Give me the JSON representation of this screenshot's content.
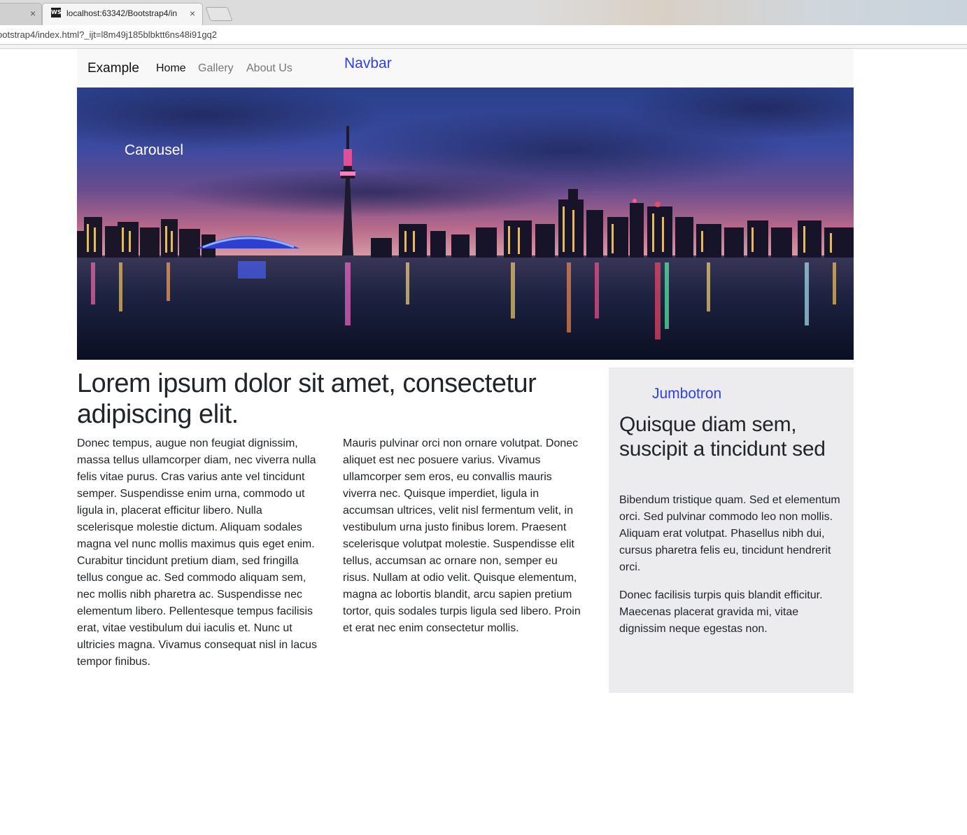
{
  "browser": {
    "inactive_tab_close": "×",
    "active_tab": {
      "favicon_text": "WS",
      "title": "localhost:63342/Bootstrap4/in",
      "close": "×"
    },
    "url": "ootstrap4/index.html?_ijt=l8m49j185blbktt6ns48i91gq2"
  },
  "navbar": {
    "brand": "Example",
    "links": [
      "Home",
      "Gallery",
      "About Us"
    ],
    "active_link": "Home",
    "annotation": "Navbar"
  },
  "carousel": {
    "annotation": "Carousel"
  },
  "main": {
    "heading": "Lorem ipsum dolor sit amet, consectetur adipiscing elit.",
    "column_left": "Donec tempus, augue non feugiat dignissim, massa tellus ullamcorper diam, nec viverra nulla felis vitae purus. Cras varius ante vel tincidunt semper. Suspendisse enim urna, commodo ut ligula in, placerat efficitur libero. Nulla scelerisque molestie dictum. Aliquam sodales magna vel nunc mollis maximus quis eget enim. Curabitur tincidunt pretium diam, sed fringilla tellus congue ac. Sed commodo aliquam sem, nec mollis nibh pharetra ac. Suspendisse nec elementum libero. Pellentesque tempus facilisis erat, vitae vestibulum dui iaculis et. Nunc ut ultricies magna. Vivamus consequat nisl in lacus tempor finibus.",
    "column_right": "Mauris pulvinar orci non ornare volutpat. Donec aliquet est nec posuere varius. Vivamus ullamcorper sem eros, eu convallis mauris viverra nec. Quisque imperdiet, ligula in accumsan ultrices, velit nisl fermentum velit, in vestibulum urna justo finibus lorem. Praesent scelerisque volutpat molestie. Suspendisse elit tellus, accumsan ac ornare non, semper eu risus. Nullam at odio velit. Quisque elementum, magna ac lobortis blandit, arcu sapien pretium tortor, quis sodales turpis ligula sed libero. Proin et erat nec enim consectetur mollis."
  },
  "jumbotron": {
    "annotation": "Jumbotron",
    "heading": "Quisque diam sem, suscipit a tincidunt sed",
    "paragraph_1": "Bibendum tristique quam. Sed et elementum orci. Sed pulvinar commodo leo non mollis. Aliquam erat volutpat. Phasellus nibh dui, cursus pharetra felis eu, tincidunt hendrerit orci.",
    "paragraph_2": "Donec facilisis turpis quis blandit efficitur. Maecenas placerat gravida mi, vitae dignissim neque egestas non."
  },
  "colors": {
    "annotation": "#2f3fe8",
    "navbar_bg": "#f8f8f8",
    "jumbotron_bg": "#ececee",
    "text": "#212529",
    "nav_inactive": "#777777"
  }
}
